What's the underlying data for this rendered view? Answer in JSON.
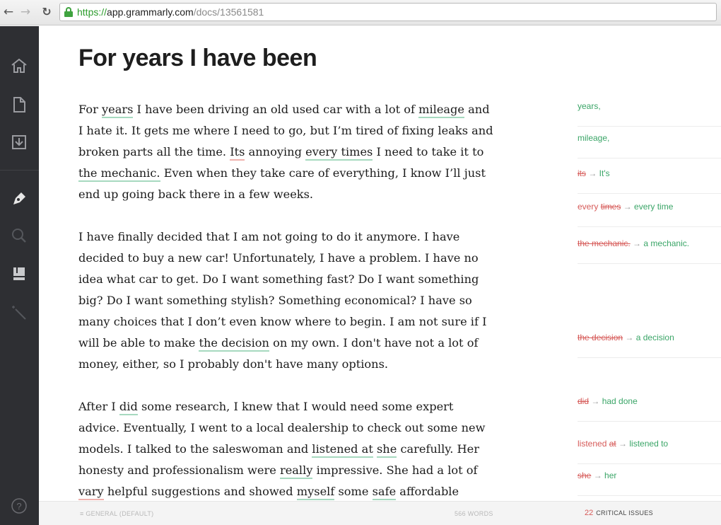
{
  "browser": {
    "url_scheme": "https://",
    "url_host": "app.grammarly.com",
    "url_path": "/docs/13561581"
  },
  "sidebar": {
    "items": [
      {
        "icon": "home-icon"
      },
      {
        "icon": "document-icon"
      },
      {
        "icon": "download-icon"
      },
      {
        "icon": "pen-icon"
      },
      {
        "icon": "search-icon"
      },
      {
        "icon": "book-icon"
      },
      {
        "icon": "magic-wand-icon"
      },
      {
        "icon": "help-icon",
        "label": "?"
      }
    ]
  },
  "document": {
    "title": "For years I have been",
    "paragraphs": [
      [
        [
          {
            "t": "For "
          },
          {
            "t": "years",
            "u": "g"
          },
          {
            "t": " I have been driving an old used car with a lot of "
          },
          {
            "t": "mileage",
            "u": "g"
          },
          {
            "t": " and"
          }
        ],
        [
          {
            "t": "I hate it. It gets me where I need to go, but I’m tired of fixing leaks and"
          }
        ],
        [
          {
            "t": "broken parts all the time. "
          },
          {
            "t": "Its",
            "u": "r"
          },
          {
            "t": " annoying "
          },
          {
            "t": "every times",
            "u": "g"
          },
          {
            "t": " I need to take it to"
          }
        ],
        [
          {
            "t": "the mechanic.",
            "u": "g"
          },
          {
            "t": " Even when they take care of everything, I know I’ll just"
          }
        ],
        [
          {
            "t": "end up going back there in a few weeks."
          }
        ]
      ],
      [
        [
          {
            "t": "I have finally decided that I am not going to do it anymore. I have"
          }
        ],
        [
          {
            "t": "decided to buy a new car! Unfortunately, I have a problem. I have no"
          }
        ],
        [
          {
            "t": "idea what car to get. Do I want something fast? Do I want something"
          }
        ],
        [
          {
            "t": "big? Do I want something stylish? Something economical? I have so"
          }
        ],
        [
          {
            "t": "many choices that I don’t even know where to begin. I am not sure if I"
          }
        ],
        [
          {
            "t": "will be able to make "
          },
          {
            "t": "the decision",
            "u": "g"
          },
          {
            "t": " on my own. I don't have not a lot of"
          }
        ],
        [
          {
            "t": "money, either, so I probably don't have many options."
          }
        ]
      ],
      [
        [
          {
            "t": "After I "
          },
          {
            "t": "did",
            "u": "g"
          },
          {
            "t": " some research, I knew that I would need some expert"
          }
        ],
        [
          {
            "t": "advice. Eventually, I went to a local dealership to check out some new"
          }
        ],
        [
          {
            "t": "models. I talked to the saleswoman and "
          },
          {
            "t": "listened at",
            "u": "g"
          },
          {
            "t": " "
          },
          {
            "t": "she",
            "u": "g"
          },
          {
            "t": " carefully. Her"
          }
        ],
        [
          {
            "t": "honesty and professionalism were "
          },
          {
            "t": "really",
            "u": "g"
          },
          {
            "t": " impressive. She had a lot of"
          }
        ],
        [
          {
            "t": "vary",
            "u": "r"
          },
          {
            "t": " helpful suggestions and showed "
          },
          {
            "t": "myself",
            "u": "g"
          },
          {
            "t": " some "
          },
          {
            "t": "safe",
            "u": "g"
          },
          {
            "t": " affordable"
          }
        ]
      ]
    ]
  },
  "suggestions": [
    {
      "parts": [
        {
          "t": "years,",
          "c": "ins"
        }
      ]
    },
    {
      "parts": [
        {
          "t": "mileage,",
          "c": "ins"
        }
      ]
    },
    {
      "parts": [
        {
          "t": "its",
          "c": "del"
        },
        {
          "t": " → ",
          "c": "arrow"
        },
        {
          "t": "It's",
          "c": "ins"
        }
      ]
    },
    {
      "parts": [
        {
          "t": "every ",
          "c": "old"
        },
        {
          "t": "times",
          "c": "del"
        },
        {
          "t": " → ",
          "c": "arrow"
        },
        {
          "t": "every ",
          "c": "ins"
        },
        {
          "t": "time",
          "c": "ins"
        }
      ]
    },
    {
      "parts": [
        {
          "t": "the mechanic.",
          "c": "del"
        },
        {
          "t": " → ",
          "c": "arrow"
        },
        {
          "t": "a mechanic.",
          "c": "ins"
        }
      ]
    },
    {
      "parts": [
        {
          "t": "the decision",
          "c": "del"
        },
        {
          "t": " → ",
          "c": "arrow"
        },
        {
          "t": "a decision",
          "c": "ins"
        }
      ]
    },
    {
      "parts": [
        {
          "t": "did",
          "c": "del"
        },
        {
          "t": " → ",
          "c": "arrow"
        },
        {
          "t": "had done",
          "c": "ins"
        }
      ]
    },
    {
      "parts": [
        {
          "t": "listened ",
          "c": "old"
        },
        {
          "t": "at",
          "c": "del"
        },
        {
          "t": " → ",
          "c": "arrow"
        },
        {
          "t": "listened ",
          "c": "ins"
        },
        {
          "t": "to",
          "c": "ins"
        }
      ]
    },
    {
      "parts": [
        {
          "t": "she",
          "c": "del"
        },
        {
          "t": " → ",
          "c": "arrow"
        },
        {
          "t": "her",
          "c": "ins"
        }
      ]
    }
  ],
  "status": {
    "mode": "≡ GENERAL (DEFAULT)",
    "words": "566 WORDS",
    "critical_count": "22",
    "critical_label": "CRITICAL ISSUES"
  },
  "colors": {
    "sidebar": "#2e2f33",
    "correct_green": "#3aa567",
    "error_red": "#d65a58",
    "underline_green": "#a6d9bf"
  }
}
